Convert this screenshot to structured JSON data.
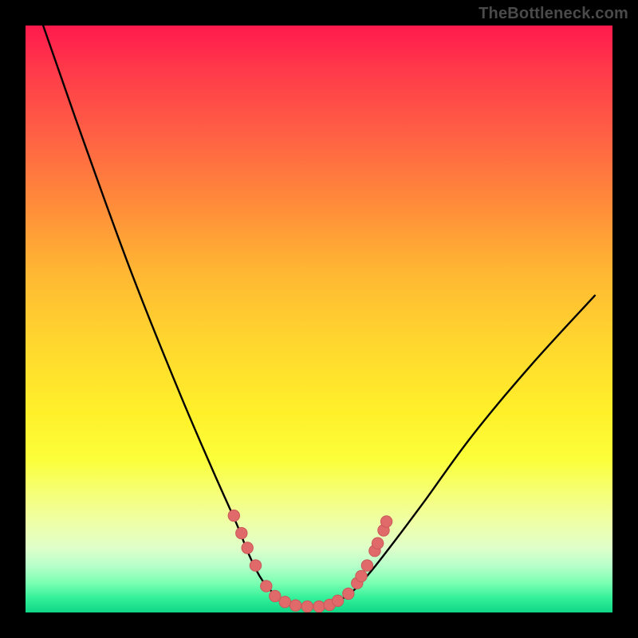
{
  "watermark": "TheBottleneck.com",
  "colors": {
    "background": "#000000",
    "curve_stroke": "#000000",
    "marker_fill": "#e06a6a",
    "marker_stroke": "#c95858",
    "gradient_stops": [
      "#ff1a4d",
      "#ff3b4a",
      "#ff5e45",
      "#ff8a3a",
      "#ffb733",
      "#ffd92e",
      "#fff02a",
      "#fbff3a",
      "#f5ff7a",
      "#eeffaa",
      "#dfffc9",
      "#b7ffca",
      "#7affb2",
      "#34f09a",
      "#0fd686"
    ]
  },
  "chart_data": {
    "type": "line",
    "title": "",
    "xlabel": "",
    "ylabel": "",
    "xlim": [
      0,
      100
    ],
    "ylim": [
      0,
      100
    ],
    "grid": false,
    "legend": false,
    "notes": "V-shaped bottleneck curve. No numeric axis ticks or labels are rendered in the image; x/y values below are in percent of plot width/height (0,0 at bottom-left) estimated from pixel positions.",
    "series": [
      {
        "name": "bottleneck-curve",
        "x": [
          3,
          10,
          18,
          26,
          32,
          36,
          38,
          40,
          42,
          44,
          46,
          48,
          50,
          52,
          55,
          58,
          62,
          68,
          76,
          86,
          97
        ],
        "y": [
          100,
          80,
          58,
          38,
          24,
          15,
          10,
          6,
          3.5,
          2,
          1.3,
          1,
          1,
          1.5,
          3,
          6,
          11,
          19,
          30,
          42,
          54
        ]
      }
    ],
    "markers": [
      {
        "x": 35.5,
        "y": 16.5
      },
      {
        "x": 36.8,
        "y": 13.5
      },
      {
        "x": 37.8,
        "y": 11.0
      },
      {
        "x": 39.2,
        "y": 8.0
      },
      {
        "x": 41.0,
        "y": 4.5
      },
      {
        "x": 42.5,
        "y": 2.8
      },
      {
        "x": 44.2,
        "y": 1.8
      },
      {
        "x": 46.0,
        "y": 1.2
      },
      {
        "x": 48.0,
        "y": 1.0
      },
      {
        "x": 50.0,
        "y": 1.0
      },
      {
        "x": 51.8,
        "y": 1.3
      },
      {
        "x": 53.2,
        "y": 2.0
      },
      {
        "x": 55.0,
        "y": 3.2
      },
      {
        "x": 56.5,
        "y": 5.0
      },
      {
        "x": 57.2,
        "y": 6.2
      },
      {
        "x": 58.2,
        "y": 8.0
      },
      {
        "x": 59.5,
        "y": 10.5
      },
      {
        "x": 60.0,
        "y": 11.8
      },
      {
        "x": 61.0,
        "y": 14.0
      },
      {
        "x": 61.5,
        "y": 15.5
      }
    ]
  }
}
